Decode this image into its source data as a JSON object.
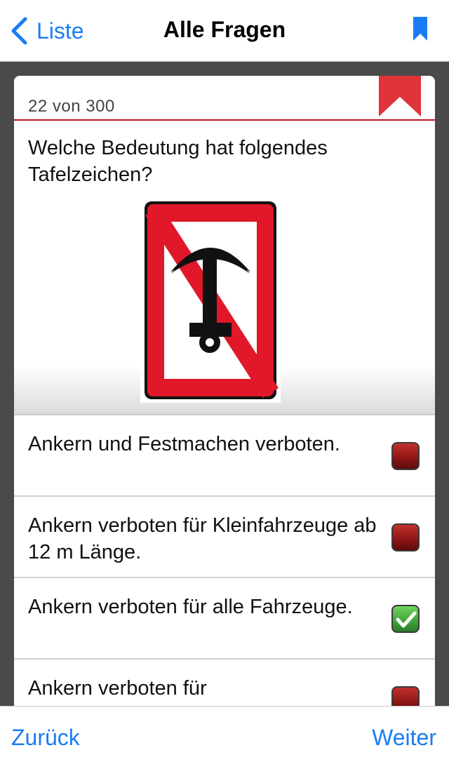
{
  "nav": {
    "back_label": "Liste",
    "title": "Alle Fragen"
  },
  "card": {
    "counter": "22 von 300",
    "question": "Welche Bedeutung hat folgendes Tafelzeichen?",
    "sign_icon": "anchor-prohibited-sign",
    "answers": [
      {
        "text": "Ankern und Festmachen verboten.",
        "checked": false
      },
      {
        "text": "Ankern verboten für Kleinfahrzeuge ab 12 m Länge.",
        "checked": false
      },
      {
        "text": "Ankern verboten für alle Fahrzeuge.",
        "checked": true
      },
      {
        "text": "Ankern verboten für",
        "checked": false
      }
    ]
  },
  "toolbar": {
    "prev_label": "Zurück",
    "next_label": "Weiter"
  },
  "colors": {
    "accent": "#1a7cf5",
    "ribbon": "#e0333a",
    "checkbox_off": "#8b1414",
    "checkbox_on": "#3fa33a"
  }
}
